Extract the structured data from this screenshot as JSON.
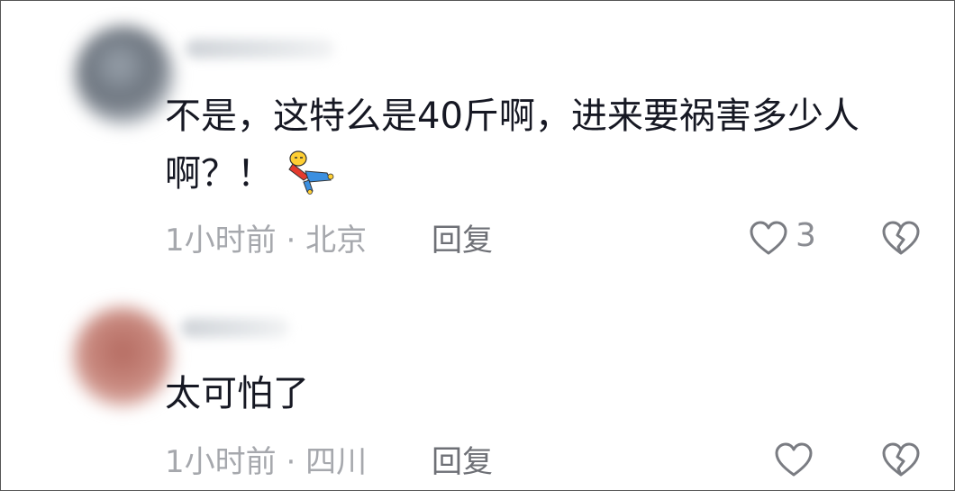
{
  "comments": [
    {
      "text": "不是，这特么是40斤啊，进来要祸害多少人啊？！",
      "sticker": "lying-doll-sticker",
      "time": "1小时前",
      "separator": "·",
      "location": "北京",
      "reply_label": "回复",
      "like_count": "3",
      "icons": [
        "heart-outline-icon",
        "broken-heart-icon"
      ]
    },
    {
      "text": "太可怕了",
      "time": "1小时前",
      "separator": "·",
      "location": "四川",
      "reply_label": "回复",
      "like_count": "",
      "icons": [
        "heart-outline-icon",
        "broken-heart-icon"
      ]
    }
  ],
  "colors": {
    "text": "#161823",
    "meta": "#a6a8ad",
    "icon": "#7a7c82"
  }
}
